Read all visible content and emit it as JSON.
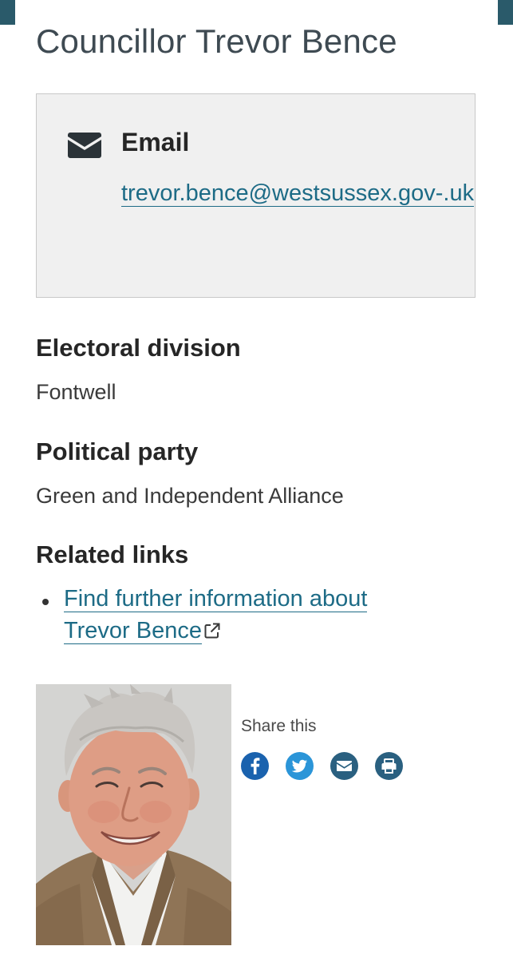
{
  "page": {
    "title": "Councillor Trevor Bence"
  },
  "contact": {
    "icon": "envelope-icon",
    "label": "Email",
    "email": "trevor.bence@westsussex.gov-.uk"
  },
  "sections": {
    "electoral_division": {
      "heading": "Electoral division",
      "value": "Fontwell"
    },
    "political_party": {
      "heading": "Political party",
      "value": "Green and Independent Alliance"
    },
    "related_links": {
      "heading": "Related links",
      "items": [
        {
          "label": "Find further information about Trevor Bence",
          "icon": "external-link-icon"
        }
      ]
    }
  },
  "portrait": {
    "alt": "Photo of Trevor Bence"
  },
  "share": {
    "label": "Share this",
    "buttons": [
      {
        "name": "facebook",
        "icon": "facebook-icon",
        "color": "#1a62ae"
      },
      {
        "name": "twitter",
        "icon": "twitter-icon",
        "color": "#2b95d8"
      },
      {
        "name": "email",
        "icon": "envelope-icon",
        "color": "#2a6080"
      },
      {
        "name": "print",
        "icon": "printer-icon",
        "color": "#2a6080"
      }
    ]
  },
  "colors": {
    "link": "#1d6b86",
    "header_accent": "#2a5a6a",
    "contact_box_bg": "#f0f0f0"
  }
}
